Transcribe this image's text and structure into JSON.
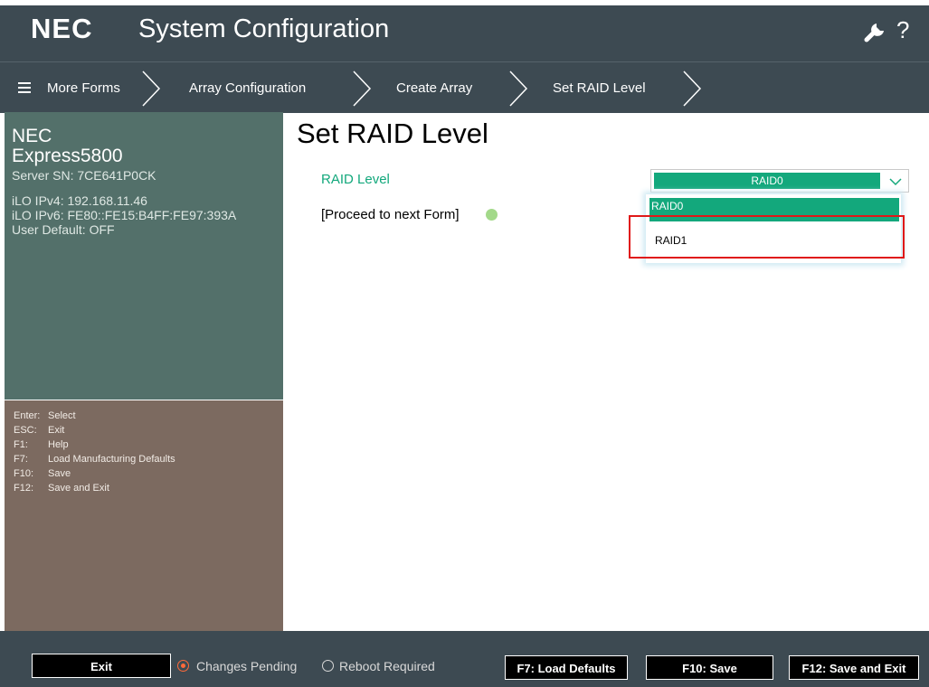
{
  "header": {
    "brand": "NEC",
    "title": "System Configuration",
    "help_glyph": "?",
    "settings_icon": "wrench-icon"
  },
  "nav": {
    "menu_label": "More Forms",
    "breadcrumbs": [
      "Array Configuration",
      "Create Array",
      "Set RAID Level"
    ]
  },
  "system_info": {
    "brand": "NEC",
    "model": "Express5800",
    "serial": "Server SN: 7CE641P0CK",
    "ilo_ipv4": "iLO IPv4: 192.168.11.46",
    "ilo_ipv6": "iLO IPv6: FE80::FE15:B4FF:FE97:393A",
    "user_default": "User Default: OFF"
  },
  "keys": [
    {
      "key": "Enter:",
      "action": "Select"
    },
    {
      "key": "ESC:",
      "action": "Exit"
    },
    {
      "key": "F1:",
      "action": "Help"
    },
    {
      "key": "F7:",
      "action": "Load Manufacturing Defaults"
    },
    {
      "key": "F10:",
      "action": "Save"
    },
    {
      "key": "F12:",
      "action": "Save and Exit"
    }
  ],
  "form": {
    "title": "Set RAID Level",
    "raid_level_label": "RAID Level",
    "raid_level_value": "RAID0",
    "options": [
      "RAID0",
      "RAID1"
    ],
    "proceed_label": "[Proceed to next Form]"
  },
  "footer": {
    "exit": "Exit",
    "changes_pending": "Changes Pending",
    "reboot_required": "Reboot Required",
    "load_defaults": "F7: Load Defaults",
    "save": "F10: Save",
    "save_exit": "F12: Save and Exit"
  },
  "colors": {
    "header_bg": "#3d4a52",
    "accent_green": "#13a87c",
    "info_panel": "#53706a",
    "keys_panel": "#7c6a60",
    "highlight_red": "#e01818"
  }
}
